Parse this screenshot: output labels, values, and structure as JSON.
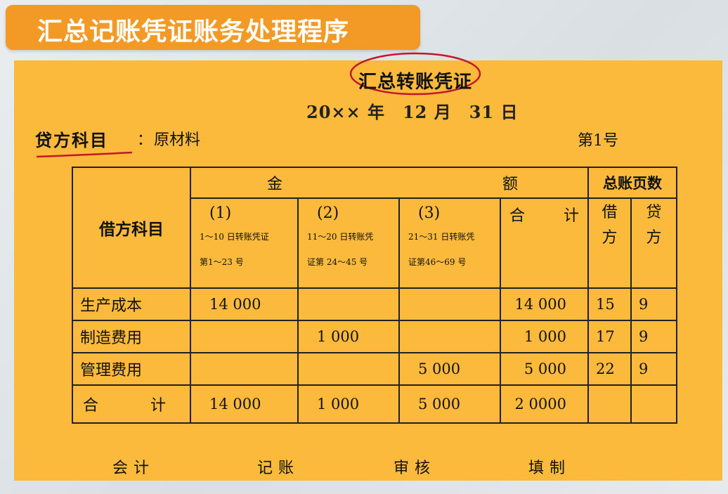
{
  "banner": {
    "title": "汇总记账凭证账务处理程序"
  },
  "voucher": {
    "title": "汇总转账凭证",
    "date": "20×× 年　12 月　31 日",
    "credit_account_label": "贷方科目",
    "credit_colon": "：",
    "credit_account_value": "原材料",
    "voucher_no": "第1号",
    "table": {
      "debit_header": "借方科目",
      "amount_header_left": "金",
      "amount_header_right": "额",
      "ledger_header": "总账页数",
      "periods": [
        {
          "num": "(1)",
          "line1": "1～10 日转账凭证",
          "line2": "第1～23 号"
        },
        {
          "num": "(2)",
          "line1": "11～20 日转账凭",
          "line2": "证第 24～45 号"
        },
        {
          "num": "(3)",
          "line1": "21～31 日转账凭",
          "line2": "证第46～69 号"
        }
      ],
      "total_header_left": "合",
      "total_header_right": "计",
      "debit_col": "借\n方",
      "credit_col": "贷\n方",
      "rows": [
        {
          "account": "生产成本",
          "p1": "14 000",
          "p2": "",
          "p3": "",
          "total": "14 000",
          "debit_page": "15",
          "credit_page": "9"
        },
        {
          "account": "制造费用",
          "p1": "",
          "p2": "1 000",
          "p3": "",
          "total": "1 000",
          "debit_page": "17",
          "credit_page": "9"
        },
        {
          "account": "管理费用",
          "p1": "",
          "p2": "",
          "p3": "5 000",
          "total": "5 000",
          "debit_page": "22",
          "credit_page": "9"
        }
      ],
      "total_row": {
        "label_left": "合",
        "label_right": "计",
        "p1": "14 000",
        "p2": "1 000",
        "p3": "5 000",
        "total": "2 0000",
        "debit_page": "",
        "credit_page": ""
      }
    },
    "signatures": [
      "会计",
      "记账",
      "审核",
      "填制"
    ]
  },
  "colors": {
    "banner": "#f39a26",
    "paper": "#fbba3c",
    "annotation": "#c0182a"
  }
}
